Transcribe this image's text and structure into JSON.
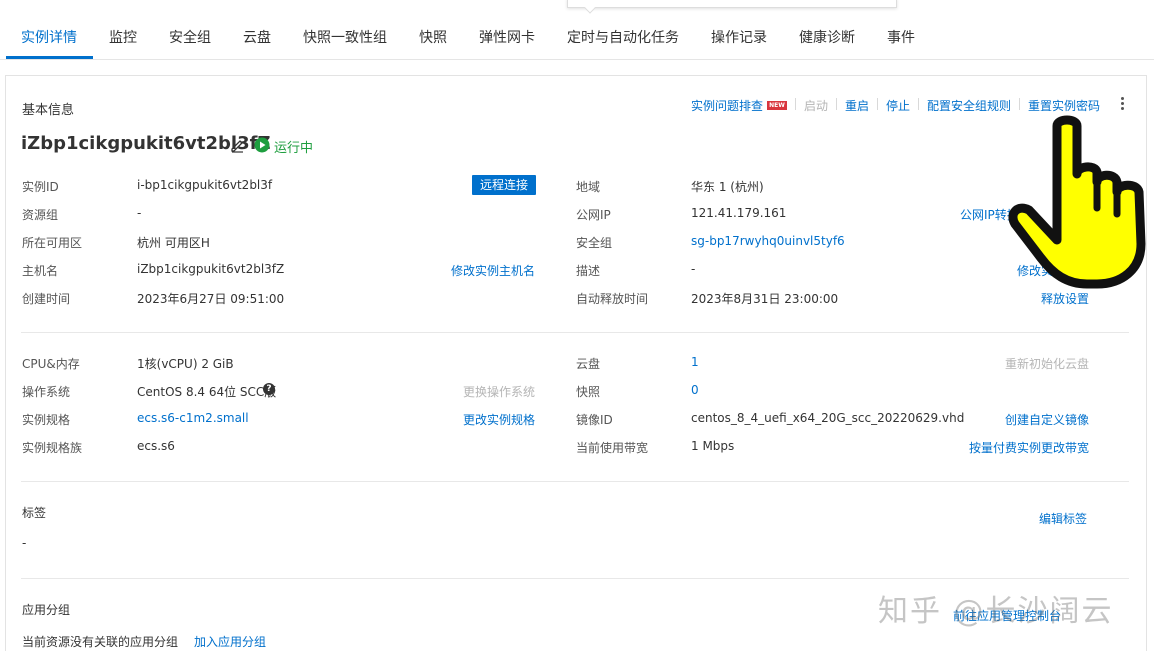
{
  "tabs": [
    "实例详情",
    "监控",
    "安全组",
    "云盘",
    "快照一致性组",
    "快照",
    "弹性网卡",
    "定时与自动化任务",
    "操作记录",
    "健康诊断",
    "事件"
  ],
  "basic_info": {
    "title": "基本信息",
    "actions": {
      "troubleshoot": "实例问题排查",
      "new_badge": "NEW",
      "start": "启动",
      "restart": "重启",
      "stop": "停止",
      "config_sg_rules": "配置安全组规则",
      "reset_password": "重置实例密码"
    },
    "instance_name": "iZbp1cikgpukit6vt2bl3fZ",
    "status": "运行中",
    "left": [
      {
        "label": "实例ID",
        "value": "i-bp1cikgpukit6vt2bl3f"
      },
      {
        "label": "资源组",
        "value": "-"
      },
      {
        "label": "所在可用区",
        "value": "杭州 可用区H"
      },
      {
        "label": "主机名",
        "value": "iZbp1cikgpukit6vt2bl3fZ"
      },
      {
        "label": "创建时间",
        "value": "2023年6月27日 09:51:00"
      }
    ],
    "remote_connect": "远程连接",
    "modify_hostname": "修改实例主机名",
    "right": [
      {
        "label": "地域",
        "value": "华东 1 (杭州)"
      },
      {
        "label": "公网IP",
        "value": "121.41.179.161"
      },
      {
        "label": "安全组",
        "value": "sg-bp17rwyhq0uinvl5tyf6"
      },
      {
        "label": "描述",
        "value": "-"
      },
      {
        "label": "自动释放时间",
        "value": "2023年8月31日 23:00:00"
      }
    ],
    "public_ip_action": "公网IP转换",
    "modify_desc": "修改实例",
    "release_settings": "释放设置"
  },
  "config": {
    "left": [
      {
        "label": "CPU&内存",
        "value": "1核(vCPU)  2 GiB"
      },
      {
        "label": "操作系统",
        "value": "CentOS 8.4 64位 SCC版"
      },
      {
        "label": "实例规格",
        "value": "ecs.s6-c1m2.small"
      },
      {
        "label": "实例规格族",
        "value": "ecs.s6"
      }
    ],
    "os_help": "?",
    "change_os": "更换操作系统",
    "change_spec": "更改实例规格",
    "right": [
      {
        "label": "云盘",
        "value": "1"
      },
      {
        "label": "快照",
        "value": "0"
      },
      {
        "label": "镜像ID",
        "value": "centos_8_4_uefi_x64_20G_scc_20220629.vhd"
      },
      {
        "label": "当前使用带宽",
        "value": "1 Mbps"
      }
    ],
    "reinit_disk": "重新初始化云盘",
    "create_image": "创建自定义镜像",
    "change_bandwidth": "按量付费实例更改带宽"
  },
  "tags": {
    "title": "标签",
    "value": "-",
    "edit": "编辑标签"
  },
  "app_group": {
    "title": "应用分组",
    "empty_text": "当前资源没有关联的应用分组",
    "add": "加入应用分组",
    "goto": "前往应用管理控制台"
  },
  "watermark": "知乎 @长沙阔云",
  "colors": {
    "accent": "#0070cc",
    "status": "#1e9e3f",
    "badge": "#d9363e",
    "hand": "#ffff00"
  },
  "icons": [
    "edit-icon",
    "running-status-icon",
    "more-icon",
    "help-icon",
    "pointer-hand-icon"
  ]
}
